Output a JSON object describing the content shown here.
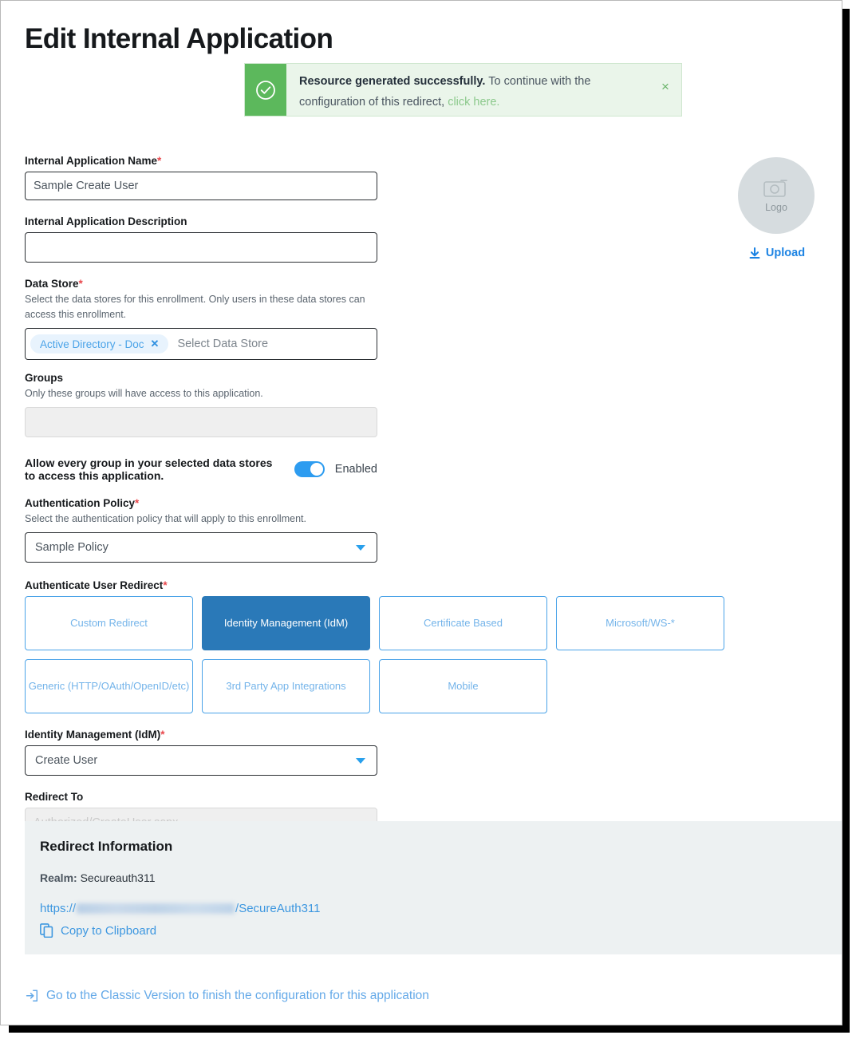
{
  "page": {
    "title": "Edit Internal Application"
  },
  "alert": {
    "icon": "check-circle-icon",
    "strong_text": "Resource generated successfully.",
    "body_text": " To continue with the configuration of this redirect, ",
    "link_text": "click here.",
    "close_label": "×",
    "accent_color": "#5cb85c",
    "background_color": "#eaf5ea",
    "link_color": "#8cc98c"
  },
  "form": {
    "app_name": {
      "label": "Internal Application Name",
      "required": "*",
      "value": "Sample Create User",
      "placeholder": ""
    },
    "app_description": {
      "label": "Internal Application Description",
      "value": "",
      "placeholder": ""
    },
    "data_store": {
      "label": "Data Store",
      "required": "*",
      "help": "Select the data stores for this enrollment. Only users in these data stores can access this enrollment.",
      "tags": [
        {
          "label": "Active Directory - Doc",
          "remove_icon": "✕"
        }
      ],
      "placeholder": "Select Data Store"
    },
    "groups": {
      "label": "Groups",
      "help": "Only these groups will have access to this application.",
      "value": "",
      "disabled": true
    },
    "allow_all_groups": {
      "label": "Allow every group in your selected data stores to access this application.",
      "state": "Enabled",
      "enabled": true,
      "accent_color": "#2d9cf0"
    },
    "auth_policy": {
      "label": "Authentication Policy",
      "required": "*",
      "help": "Select the authentication policy that will apply to this enrollment.",
      "value": "Sample Policy"
    },
    "authenticate_user_redirect": {
      "label": "Authenticate User Redirect",
      "required": "*",
      "options": [
        {
          "label": "Custom Redirect",
          "selected": false
        },
        {
          "label": "Identity Management (IdM)",
          "selected": true
        },
        {
          "label": "Certificate Based",
          "selected": false
        },
        {
          "label": "Microsoft/WS-*",
          "selected": false
        },
        {
          "label": "Generic (HTTP/OAuth/OpenID/etc)",
          "selected": false
        },
        {
          "label": "3rd Party App Integrations",
          "selected": false
        },
        {
          "label": "Mobile",
          "selected": false
        }
      ],
      "selected_color": "#2a79b8",
      "border_color": "#4aa3e8"
    },
    "idm": {
      "label": "Identity Management (IdM)",
      "required": "*",
      "value": "Create User"
    },
    "redirect_to": {
      "label": "Redirect To",
      "value": "",
      "placeholder": "Authorized/CreateUser.aspx",
      "disabled": true
    }
  },
  "logo": {
    "icon": "camera-icon",
    "caption": "Logo",
    "upload_label": "Upload",
    "upload_icon": "download-arrow-icon",
    "upload_color": "#1c83e3"
  },
  "redirect_information": {
    "title": "Redirect Information",
    "realm_label": "Realm:",
    "realm_value": "Secureauth311",
    "url_prefix": "https://",
    "url_suffix": "/SecureAuth311",
    "copy_label": "Copy to Clipboard",
    "copy_icon": "copy-icon",
    "background_color": "#edf1f2"
  },
  "footer": {
    "link_text": "Go to the Classic Version to finish the configuration for this application",
    "link_icon": "sign-in-arrow-icon",
    "link_color": "#64a9e8"
  }
}
